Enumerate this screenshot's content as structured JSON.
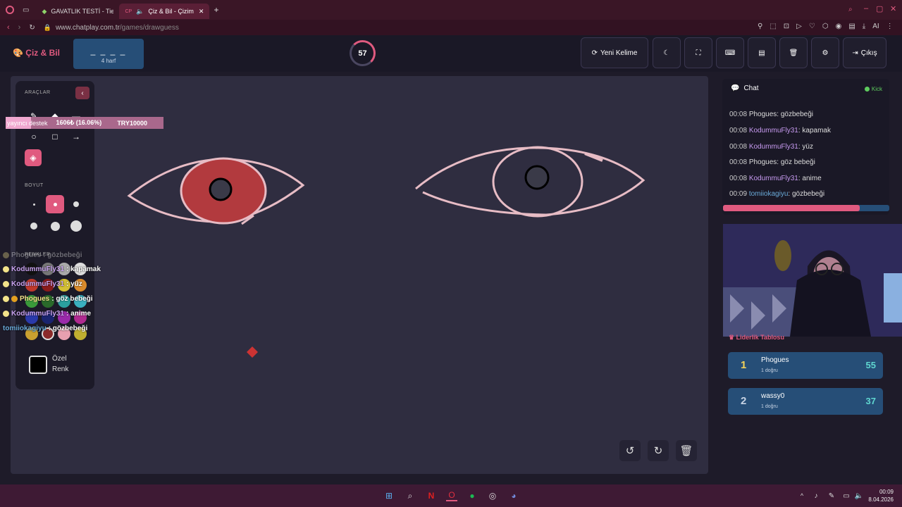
{
  "browser": {
    "tabs": [
      {
        "label": "GAVATLIK TESTİ - Tier List"
      },
      {
        "label": "Çiz & Bil - Çizim Oy"
      }
    ],
    "url_host": "www.chatplay.com.tr",
    "url_path": "/games/drawguess",
    "ai_label": "AI"
  },
  "header": {
    "logo": "Çiz & Bil",
    "word_mask": "_ _ _ _",
    "word_hint": "4 harf",
    "timer": "57",
    "timer_progress": 0.3,
    "new_word": "Yeni Kelime",
    "exit": "Çıkış"
  },
  "tools": {
    "section_tools": "ARAÇLAR",
    "section_size": "BOYUT",
    "section_colors": "RENKLER",
    "custom_color_line1": "Özel",
    "custom_color_line2": "Renk"
  },
  "overlay": {
    "donation_tag": "yayıncı destek",
    "donation_amount": "1606₺ (16.06%)",
    "donation_goal": "TRY10000",
    "progress": 0.1606,
    "faded_line": "Phogues : gözbebeği",
    "lines": [
      {
        "user": "KodummuFly31",
        "text": ": kapamak"
      },
      {
        "user": "KodummuFly31",
        "text": ": yüz"
      },
      {
        "user": "Phogues",
        "text": ": göz bebeği"
      },
      {
        "user": "KodummuFly31",
        "text": ": anime"
      },
      {
        "user": "tomiiokagiyu",
        "text": ": gözbebeği"
      }
    ]
  },
  "chat": {
    "title": "Chat",
    "platform": "Kick",
    "messages": [
      {
        "time": "00:08",
        "user": "Phogues",
        "text": ": gözbebeği"
      },
      {
        "time": "00:08",
        "user": "KodummuFly31",
        "text": ": kapamak"
      },
      {
        "time": "00:08",
        "user": "KodummuFly31",
        "text": ": yüz"
      },
      {
        "time": "00:08",
        "user": "Phogues",
        "text": ": göz bebeği"
      },
      {
        "time": "00:08",
        "user": "KodummuFly31",
        "text": ": anime"
      },
      {
        "time": "00:09",
        "user": "tomiiokagiyu",
        "text": ": gözbebeği"
      }
    ],
    "scroll_position": 0.82
  },
  "leaderboard": {
    "title": "Liderlik Tablosu",
    "rows": [
      {
        "rank": "1",
        "name": "Phogues",
        "sub": "1 doğru",
        "score": "55"
      },
      {
        "rank": "2",
        "name": "wassy0",
        "sub": "1 doğru",
        "score": "37"
      }
    ]
  },
  "taskbar": {
    "time": "00:09",
    "date": "8.04.2026"
  },
  "colors": {
    "accent": "#e05a7f",
    "panel_blue": "#264e77"
  }
}
